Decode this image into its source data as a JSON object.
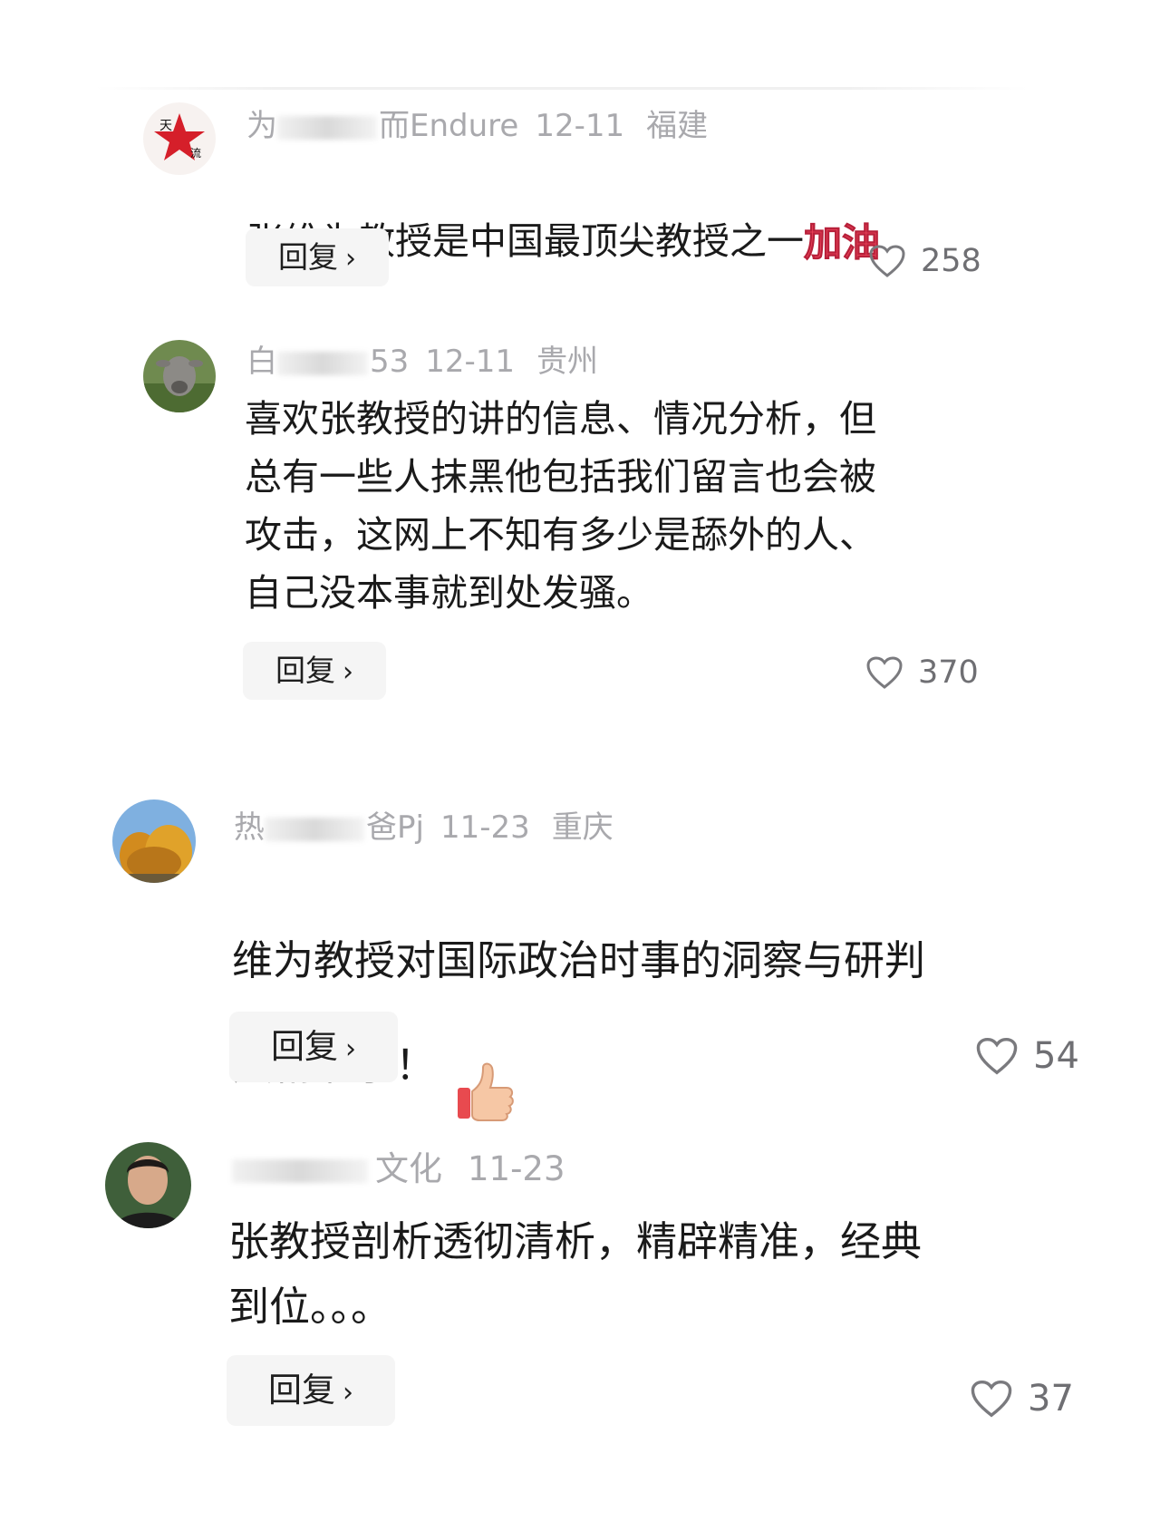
{
  "comments": [
    {
      "username_visible_start": "为",
      "username_visible_end": "而Endure",
      "date": "12-11",
      "location": "福建",
      "text": "张维为教授是中国最顶尖教授之一",
      "emoji": "加油",
      "reply_label": "回复",
      "likes": "258"
    },
    {
      "username_visible_start": "白",
      "username_visible_end": "53",
      "date": "12-11",
      "location": "贵州",
      "text": "喜欢张教授的讲的信息、情况分析，但\n总有一些人抹黑他包括我们留言也会被\n攻击，这网上不知有多少是舔外的人、\n自己没本事就到处发骚。",
      "reply_label": "回复",
      "likes": "370"
    },
    {
      "username_visible_start": "热",
      "username_visible_end": "爸Pj",
      "date": "11-23",
      "location": "重庆",
      "text": "维为教授对国际政治时事的洞察与研判\n太精准了！",
      "emoji": "thumbs-up",
      "reply_label": "回复",
      "likes": "54"
    },
    {
      "username_visible_start": "",
      "username_visible_end": "文化",
      "date": "11-23",
      "location": "",
      "text": "张教授剖析透彻清析，精辟精准，经典\n到位。。。",
      "reply_label": "回复",
      "likes": "37"
    }
  ],
  "colors": {
    "meta_text": "#a9a9ad",
    "body_text": "#1a1a1a",
    "reply_bg": "#f5f5f5",
    "like_text": "#6f6f73"
  }
}
